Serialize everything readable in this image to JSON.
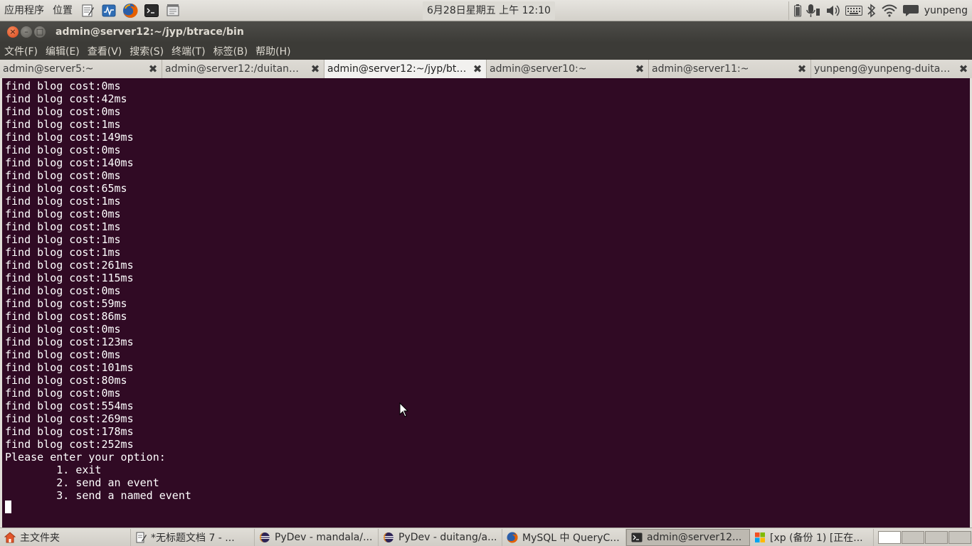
{
  "top_panel": {
    "menus": [
      "应用程序",
      "位置"
    ],
    "clock": "6月28日星期五 上午 12:10",
    "user": "yunpeng"
  },
  "window": {
    "title": "admin@server12:~/jyp/btrace/bin"
  },
  "menubar": [
    "文件(F)",
    "编辑(E)",
    "查看(V)",
    "搜索(S)",
    "终端(T)",
    "标签(B)",
    "帮助(H)"
  ],
  "tabs": [
    {
      "label": "admin@server5:~",
      "active": false
    },
    {
      "label": "admin@server12:/duitang/...",
      "active": false
    },
    {
      "label": "admin@server12:~/jyp/btr...",
      "active": true
    },
    {
      "label": "admin@server10:~",
      "active": false
    },
    {
      "label": "admin@server11:~",
      "active": false
    },
    {
      "label": "yunpeng@yunpeng-duitang: ~",
      "active": false
    }
  ],
  "terminal": {
    "lines": [
      "find blog cost:0ms",
      "find blog cost:42ms",
      "find blog cost:0ms",
      "find blog cost:1ms",
      "find blog cost:149ms",
      "find blog cost:0ms",
      "find blog cost:140ms",
      "find blog cost:0ms",
      "find blog cost:65ms",
      "find blog cost:1ms",
      "find blog cost:0ms",
      "find blog cost:1ms",
      "find blog cost:1ms",
      "find blog cost:1ms",
      "find blog cost:261ms",
      "find blog cost:115ms",
      "find blog cost:0ms",
      "find blog cost:59ms",
      "find blog cost:86ms",
      "find blog cost:0ms",
      "find blog cost:123ms",
      "find blog cost:0ms",
      "find blog cost:101ms",
      "find blog cost:80ms",
      "find blog cost:0ms",
      "find blog cost:554ms",
      "find blog cost:269ms",
      "find blog cost:178ms",
      "find blog cost:252ms",
      "Please enter your option:",
      "        1. exit",
      "        2. send an event",
      "        3. send a named event"
    ]
  },
  "taskbar": [
    {
      "label": "主文件夹",
      "icon": "home-folder-icon",
      "active": false
    },
    {
      "label": "*无标题文档 7 - ...",
      "icon": "text-editor-icon",
      "active": false
    },
    {
      "label": "PyDev - mandala/...",
      "icon": "eclipse-icon",
      "active": false
    },
    {
      "label": "PyDev - duitang/a...",
      "icon": "eclipse-icon",
      "active": false
    },
    {
      "label": "MySQL 中 QueryC...",
      "icon": "firefox-icon",
      "active": false
    },
    {
      "label": "admin@server12...",
      "icon": "terminal-icon",
      "active": true
    },
    {
      "label": "[xp (备份 1) [正在...",
      "icon": "virtualbox-icon",
      "active": false
    }
  ],
  "colors": {
    "terminal_bg": "#300a24",
    "terminal_fg": "#ffffff",
    "titlebar_bg": "#3c3b37",
    "close_button": "#e0541e"
  }
}
